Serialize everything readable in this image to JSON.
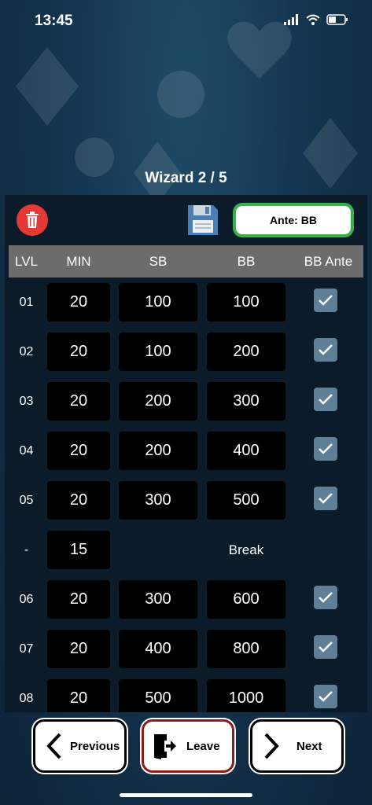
{
  "status": {
    "time": "13:45"
  },
  "title": "Wizard 2 / 5",
  "toolbar": {
    "ante_label": "Ante: BB"
  },
  "headers": {
    "lvl": "LVL",
    "min": "MIN",
    "sb": "SB",
    "bb": "BB",
    "ante": "BB Ante"
  },
  "rows": [
    {
      "lvl": "01",
      "min": "20",
      "sb": "100",
      "bb": "100",
      "ante": true
    },
    {
      "lvl": "02",
      "min": "20",
      "sb": "100",
      "bb": "200",
      "ante": true
    },
    {
      "lvl": "03",
      "min": "20",
      "sb": "200",
      "bb": "300",
      "ante": true
    },
    {
      "lvl": "04",
      "min": "20",
      "sb": "200",
      "bb": "400",
      "ante": true
    },
    {
      "lvl": "05",
      "min": "20",
      "sb": "300",
      "bb": "500",
      "ante": true
    },
    {
      "lvl": "-",
      "min": "15",
      "break_label": "Break"
    },
    {
      "lvl": "06",
      "min": "20",
      "sb": "300",
      "bb": "600",
      "ante": true
    },
    {
      "lvl": "07",
      "min": "20",
      "sb": "400",
      "bb": "800",
      "ante": true
    },
    {
      "lvl": "08",
      "min": "20",
      "sb": "500",
      "bb": "1000",
      "ante": true
    }
  ],
  "nav": {
    "previous": "Previous",
    "leave": "Leave",
    "next": "Next"
  },
  "colors": {
    "ante_border": "#35b34a",
    "delete": "#e53935",
    "leave_border": "#8e1b1b",
    "checkbox": "#5e7f95"
  },
  "icons": [
    "trash-icon",
    "save-icon",
    "check-icon",
    "chevron-left-icon",
    "exit-door-icon",
    "chevron-right-icon"
  ]
}
